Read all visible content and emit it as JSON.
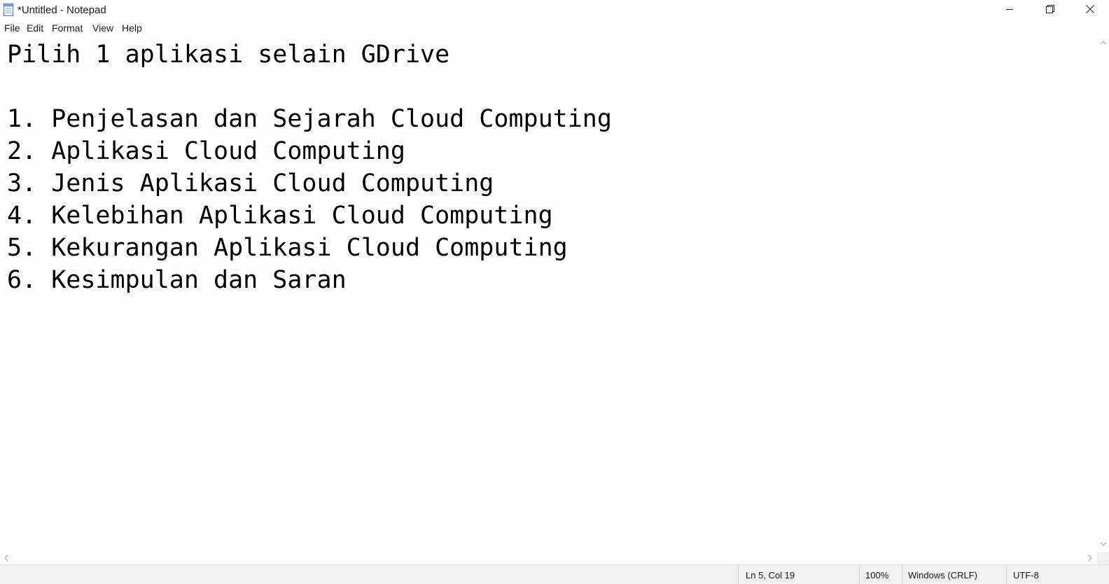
{
  "window": {
    "title": "*Untitled - Notepad",
    "icon": "notepad-icon",
    "controls": [
      "minimize-icon",
      "restore-icon",
      "close-icon"
    ]
  },
  "menu": {
    "file": "File",
    "edit": "Edit",
    "format": "Format",
    "view": "View",
    "help": "Help"
  },
  "editor": {
    "lines": [
      "Pilih 1 aplikasi selain GDrive",
      "",
      "1. Penjelasan dan Sejarah Cloud Computing",
      "2. Aplikasi Cloud Computing",
      "3. Jenis Aplikasi Cloud Computing",
      "4. Kelebihan Aplikasi Cloud Computing",
      "5. Kekurangan Aplikasi Cloud Computing",
      "6. Kesimpulan dan Saran"
    ]
  },
  "status": {
    "position": "Ln 5, Col 19",
    "zoom": "100%",
    "line_ending": "Windows (CRLF)",
    "encoding": "UTF-8"
  },
  "colors": {
    "text": "#000000",
    "status_bg": "#f0f0f0",
    "editor_bg": "#fefefe"
  }
}
